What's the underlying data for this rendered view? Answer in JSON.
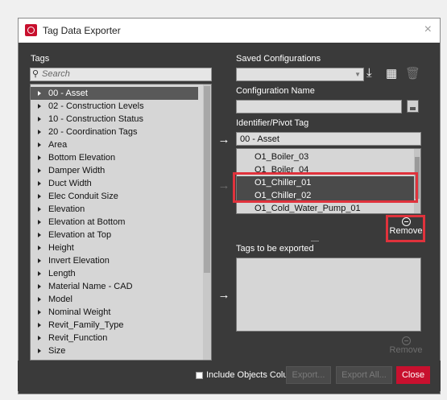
{
  "window": {
    "title": "Tag Data Exporter",
    "close_glyph": "×"
  },
  "left": {
    "tags_label": "Tags",
    "search_placeholder": "Search",
    "tags": [
      "00 - Asset",
      "02 - Construction Levels",
      "10 - Construction Status",
      "20 - Coordination Tags",
      "Area",
      "Bottom Elevation",
      "Damper Width",
      "Duct Width",
      "Elec Conduit Size",
      "Elevation",
      "Elevation at Bottom",
      "Elevation at Top",
      "Height",
      "Invert Elevation",
      "Length",
      "Material Name - CAD",
      "Model",
      "Nominal Weight",
      "Revit_Family_Type",
      "Revit_Function",
      "Size"
    ],
    "selected_tag_index": 0
  },
  "arrows": {
    "add_identifier": "→",
    "add_values": "→",
    "add_export": "→"
  },
  "right": {
    "saved_label": "Saved Configurations",
    "saved_value": "",
    "config_name_label": "Configuration Name",
    "config_name_value": "",
    "identifier_label": "Identifier/Pivot Tag",
    "identifier_value": "00 - Asset",
    "identifier_values": [
      "O1_Boiler_03",
      "O1_Boiler_04",
      "O1_Chiller_01",
      "O1_Chiller_02",
      "O1_Cold_Water_Pump_01"
    ],
    "selected_values": [
      2,
      3
    ],
    "remove_label": "Remove",
    "export_label": "Tags to be exported",
    "remove2_label": "Remove"
  },
  "icons": {
    "download": "download-icon",
    "grid": "grid-icon",
    "delete": "trash-icon",
    "save": "save-icon",
    "search": "search-icon"
  },
  "footer": {
    "include_objects_label": "Include Objects Column",
    "export_label": "Export...",
    "export_all_label": "Export All...",
    "close_label": "Close"
  },
  "colors": {
    "accent": "#c8102e",
    "highlight": "#e0323c",
    "panel": "#3a3a3a"
  }
}
